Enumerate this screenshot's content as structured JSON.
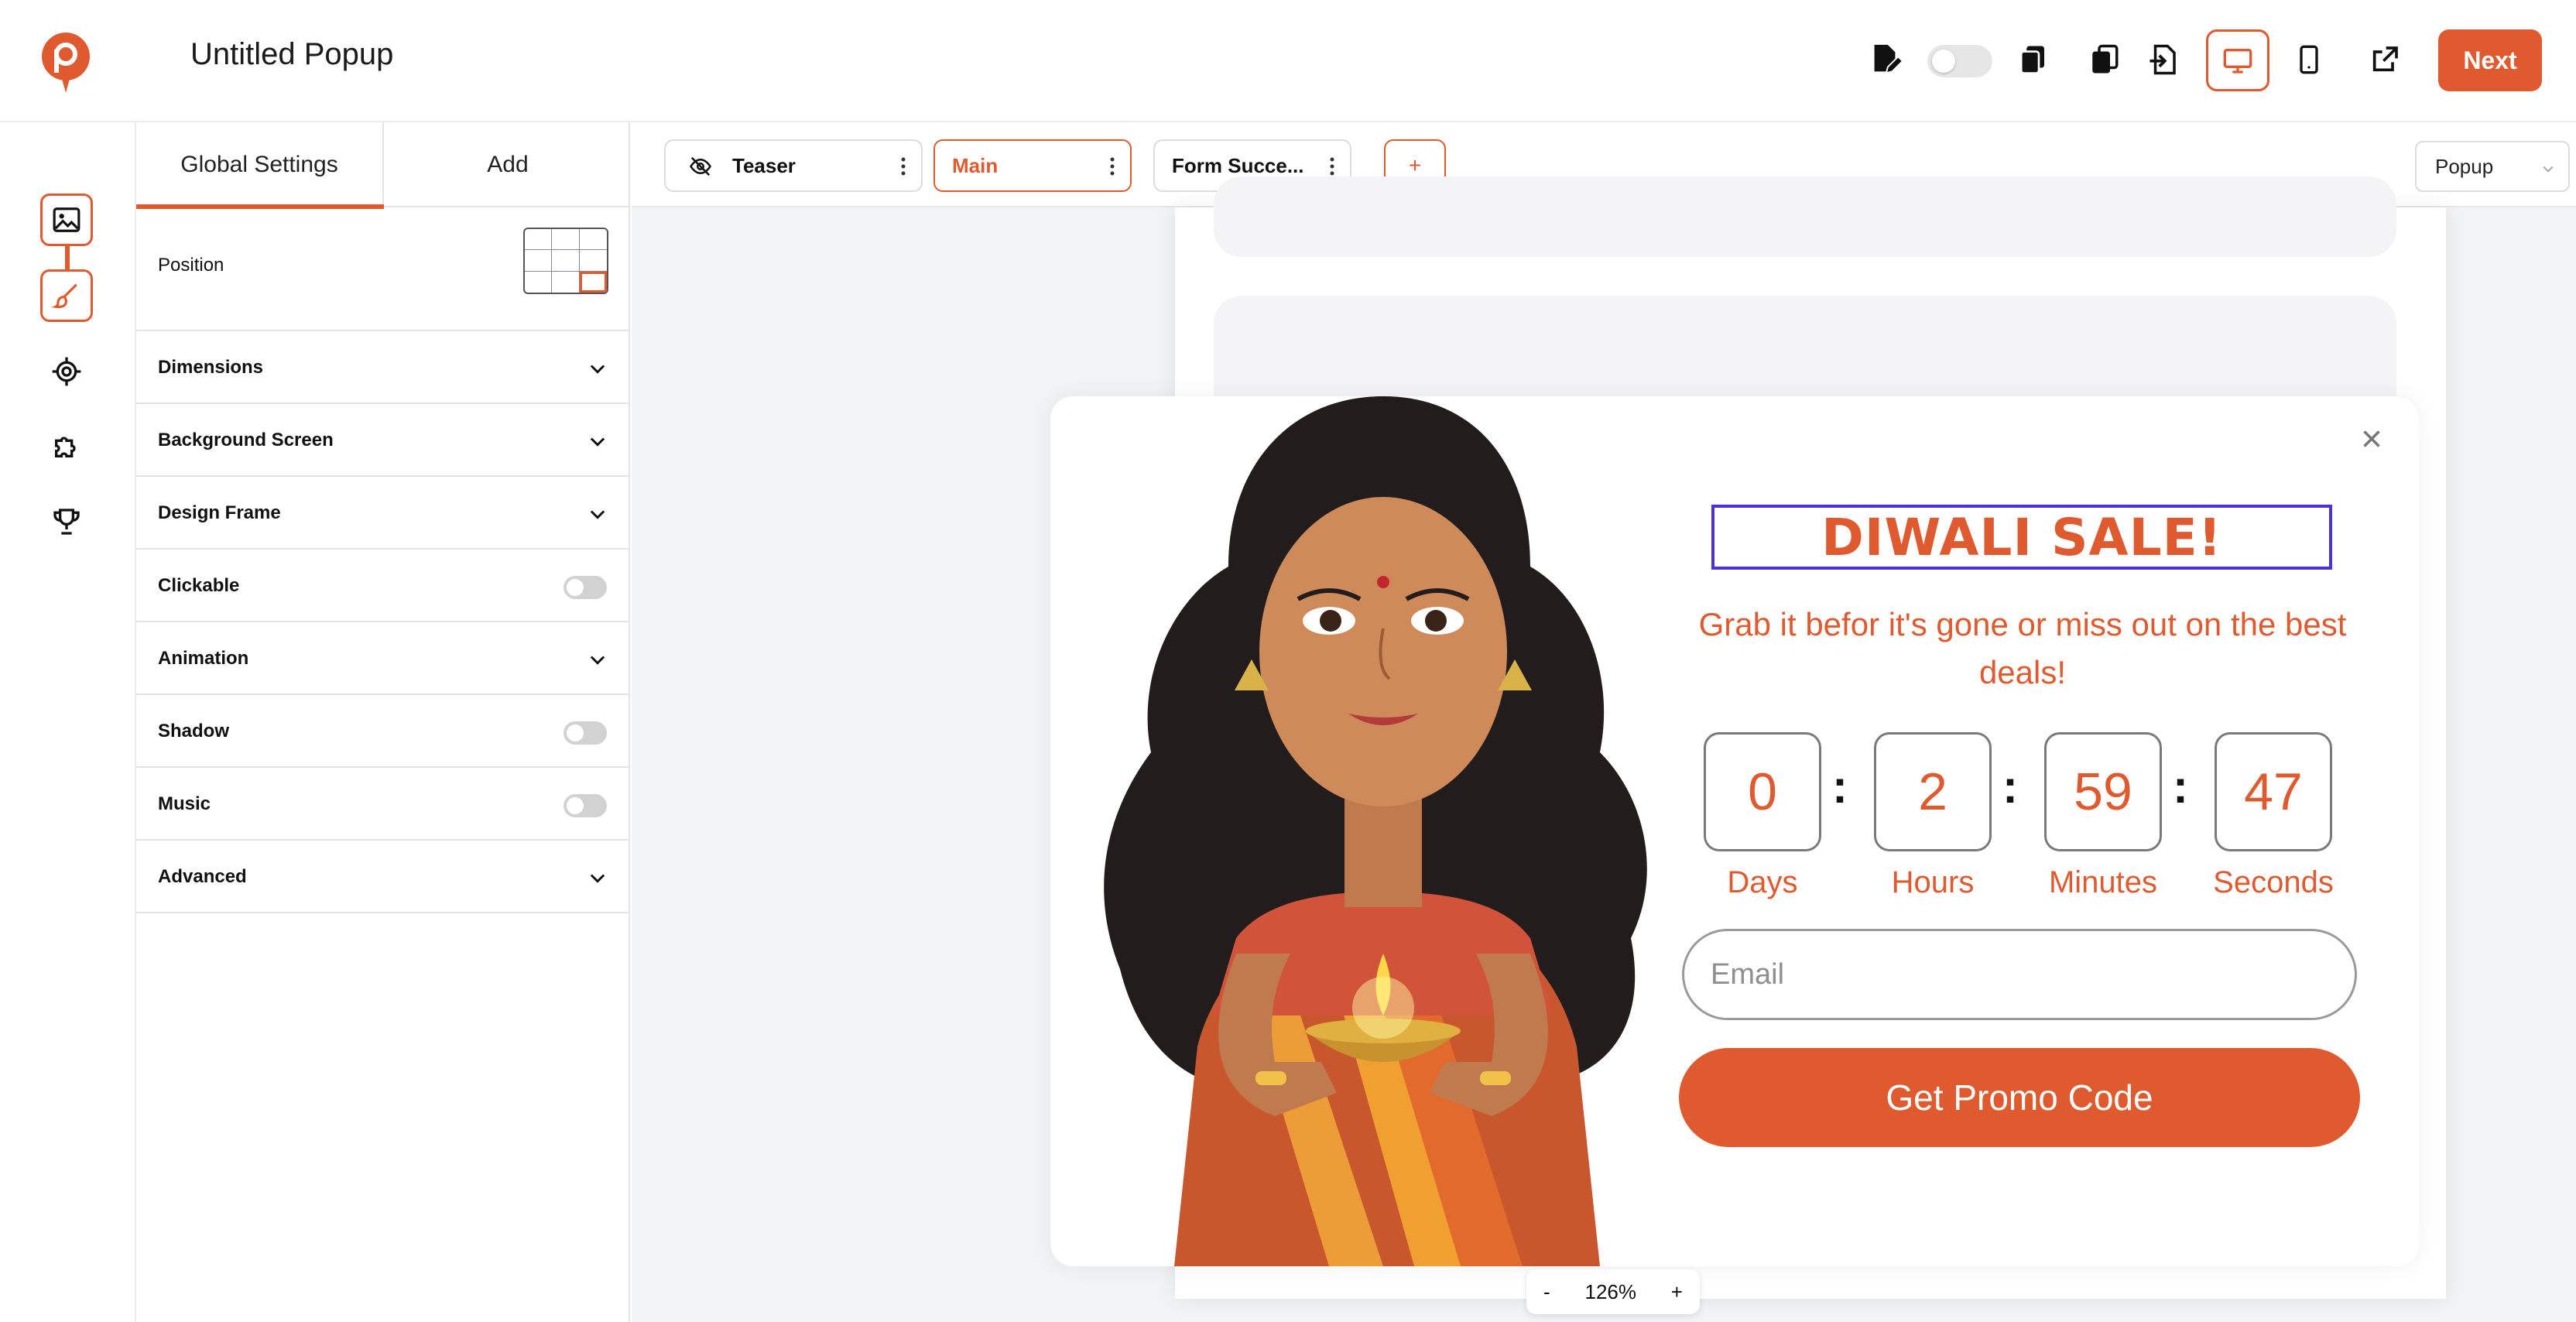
{
  "app": {
    "title": "Untitled Popup",
    "next_label": "Next",
    "accent_color": "#e05a2f"
  },
  "toolbar": {
    "icons": [
      "edit-file-icon",
      "preview-toggle",
      "copy-icon",
      "duplicate-icon",
      "import-icon",
      "desktop-view-icon",
      "mobile-view-icon",
      "external-link-icon"
    ]
  },
  "rail": {
    "items": [
      "image-icon",
      "brush-icon",
      "target-icon",
      "puzzle-icon",
      "trophy-icon"
    ]
  },
  "panel": {
    "tabs": [
      "Global Settings",
      "Add"
    ],
    "position_label": "Position",
    "rows": [
      {
        "label": "Dimensions",
        "control": "chevron"
      },
      {
        "label": "Background Screen",
        "control": "chevron"
      },
      {
        "label": "Design Frame",
        "control": "chevron"
      },
      {
        "label": "Clickable",
        "control": "toggle"
      },
      {
        "label": "Animation",
        "control": "chevron"
      },
      {
        "label": "Shadow",
        "control": "toggle"
      },
      {
        "label": "Music",
        "control": "toggle"
      },
      {
        "label": "Advanced",
        "control": "chevron"
      }
    ]
  },
  "steps": {
    "tabs": [
      {
        "label": "Teaser",
        "active": false
      },
      {
        "label": "Main",
        "active": true
      },
      {
        "label": "Form Succe...",
        "active": false
      }
    ],
    "add_label": "+",
    "type_select": "Popup"
  },
  "popup": {
    "headline": "DIWALI SALE!",
    "subtext": "Grab it befor it's gone or miss out on the best deals!",
    "countdown": [
      {
        "value": "0",
        "label": "Days"
      },
      {
        "value": "2",
        "label": "Hours"
      },
      {
        "value": "59",
        "label": "Minutes"
      },
      {
        "value": "47",
        "label": "Seconds"
      }
    ],
    "email_placeholder": "Email",
    "cta_label": "Get Promo Code"
  },
  "zoom": {
    "minus": "-",
    "level": "126%",
    "plus": "+"
  }
}
